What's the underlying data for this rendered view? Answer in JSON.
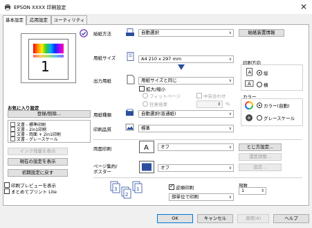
{
  "window": {
    "title": "EPSON XXXX 印刷設定",
    "close_glyph": "✕"
  },
  "tabs": [
    {
      "label": "基本設定",
      "active": true
    },
    {
      "label": "応用設定",
      "active": false
    },
    {
      "label": "ユーティリティー",
      "active": false
    }
  ],
  "preview": {
    "page_number": "1"
  },
  "favorites": {
    "heading": "お気に入り設定",
    "register_label": "登録/削除...",
    "items": [
      "文書 - 標準印刷",
      "文書 - 2in1印刷",
      "文書 - 両面 + 2in1印刷",
      "文書 - グレースケール"
    ]
  },
  "left_buttons": {
    "ink_level": "インク残量を表示",
    "show_current": "現在の設定を表示",
    "reset": "初期設定に戻す"
  },
  "left_checks": {
    "print_preview": {
      "label": "印刷プレビューを表示",
      "checked": false
    },
    "lite": {
      "label": "まとめてプリント Lite",
      "checked": false
    }
  },
  "paper_source": {
    "label": "給紙方法",
    "value": "自動選択",
    "info_button": "給紙装置情報"
  },
  "paper_size": {
    "label": "用紙サイズ",
    "value": "A4 210 x 297 mm"
  },
  "output_paper": {
    "label": "出力用紙",
    "value": "用紙サイズと同じ"
  },
  "scaling": {
    "label": "拡大/縮小",
    "checked": false,
    "fit_page": "フィットページ",
    "center": "中央合わせ",
    "any_ratio": "任意倍率",
    "percent_unit": "%"
  },
  "orientation": {
    "label": "印刷方向",
    "portrait": "縦",
    "landscape": "横",
    "selected": "portrait"
  },
  "media_type": {
    "label": "用紙種類",
    "value": "自動選択(普通紙)"
  },
  "quality": {
    "label": "印刷品質",
    "value": "標準"
  },
  "color": {
    "label": "カラー",
    "color_option": "カラー(自動)",
    "gray_option": "グレースケール",
    "selected": "color"
  },
  "duplex": {
    "label": "両面印刷",
    "value": "オフ",
    "settings_button": "とじ方設定...",
    "density_button": "濃度調整...",
    "config_button": "設定..."
  },
  "multipage": {
    "label": "ページ集約/\nポスター",
    "value": "オフ"
  },
  "collate": {
    "label": "逆順印刷",
    "checked": true,
    "order_value": "部単位で印刷"
  },
  "copies": {
    "label": "部数",
    "value": "1"
  },
  "bottom_buttons": {
    "ok": "OK",
    "cancel": "キャンセル",
    "apply": "適用(A)",
    "help": "ヘルプ"
  },
  "colors": {
    "accent_blue": "#2b4f9e",
    "disabled": "#a0a0a0"
  }
}
